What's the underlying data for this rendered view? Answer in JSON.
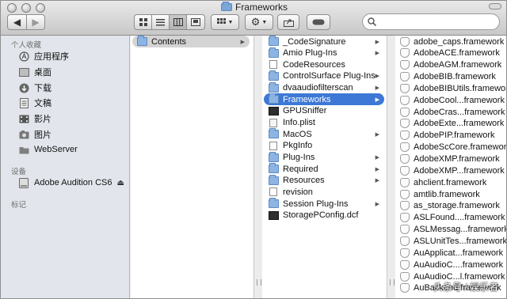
{
  "window": {
    "title": "Frameworks"
  },
  "toolbar": {
    "back_icon": "chevron-left",
    "forward_icon": "chevron-right",
    "view_icons": [
      "icon-view",
      "list-view",
      "column-view",
      "coverflow-view"
    ],
    "arrange_icon": "grid-arrange",
    "action_icon": "gear",
    "share_icon": "share",
    "tag_icon": "tag",
    "search_placeholder": ""
  },
  "sidebar": {
    "favorites_header": "个人收藏",
    "favorites": [
      {
        "label": "应用程序",
        "icon": "applications-icon"
      },
      {
        "label": "桌面",
        "icon": "desktop-icon"
      },
      {
        "label": "下载",
        "icon": "download-icon"
      },
      {
        "label": "文稿",
        "icon": "documents-icon"
      },
      {
        "label": "影片",
        "icon": "movies-icon"
      },
      {
        "label": "图片",
        "icon": "pictures-icon"
      },
      {
        "label": "WebServer",
        "icon": "folder-icon"
      }
    ],
    "devices_header": "设备",
    "devices": [
      {
        "label": "Adobe Audition CS6",
        "icon": "disk-icon",
        "eject": "⏏"
      }
    ],
    "tags_header": "标记"
  },
  "columns": {
    "col1": [
      {
        "label": "Contents",
        "type": "folder",
        "arrow": "▶",
        "state": "grey"
      }
    ],
    "col2": [
      {
        "label": "_CodeSignature",
        "type": "folder",
        "arrow": "▶"
      },
      {
        "label": "Amio Plug-Ins",
        "type": "folder",
        "arrow": "▶"
      },
      {
        "label": "CodeResources",
        "type": "file",
        "arrow": ""
      },
      {
        "label": "ControlSurface Plug-Ins",
        "type": "folder",
        "arrow": "▶"
      },
      {
        "label": "dvaaudiofilterscan",
        "type": "folder",
        "arrow": "▶"
      },
      {
        "label": "Frameworks",
        "type": "folder",
        "arrow": "▶",
        "state": "selected"
      },
      {
        "label": "GPUSniffer",
        "type": "exec",
        "arrow": ""
      },
      {
        "label": "Info.plist",
        "type": "plist",
        "arrow": ""
      },
      {
        "label": "MacOS",
        "type": "folder",
        "arrow": "▶"
      },
      {
        "label": "PkgInfo",
        "type": "file",
        "arrow": ""
      },
      {
        "label": "Plug-Ins",
        "type": "folder",
        "arrow": "▶"
      },
      {
        "label": "Required",
        "type": "folder",
        "arrow": "▶"
      },
      {
        "label": "Resources",
        "type": "folder",
        "arrow": "▶"
      },
      {
        "label": "revision",
        "type": "file",
        "arrow": ""
      },
      {
        "label": "Session Plug-Ins",
        "type": "folder",
        "arrow": "▶"
      },
      {
        "label": "StoragePConfig.dcf",
        "type": "exec",
        "arrow": ""
      }
    ],
    "col3": [
      {
        "label": "adobe_caps.framework"
      },
      {
        "label": "AdobeACE.framework"
      },
      {
        "label": "AdobeAGM.framework"
      },
      {
        "label": "AdobeBIB.framework"
      },
      {
        "label": "AdobeBIBUtils.framework"
      },
      {
        "label": "AdobeCool...framework"
      },
      {
        "label": "AdobeCras...framework"
      },
      {
        "label": "AdobeExte...framework"
      },
      {
        "label": "AdobePIP.framework"
      },
      {
        "label": "AdobeScCore.framework"
      },
      {
        "label": "AdobeXMP.framework"
      },
      {
        "label": "AdobeXMP...framework"
      },
      {
        "label": "ahclient.framework"
      },
      {
        "label": "amtlib.framework"
      },
      {
        "label": "as_storage.framework"
      },
      {
        "label": "ASLFound....framework"
      },
      {
        "label": "ASLMessag...framework"
      },
      {
        "label": "ASLUnitTes...framework"
      },
      {
        "label": "AuApplicat...framework"
      },
      {
        "label": "AuAudioC....framework"
      },
      {
        "label": "AuAudioC...l.framework"
      },
      {
        "label": "AuBackend.framework"
      }
    ]
  },
  "watermark": "头条号 / 娱乐者"
}
